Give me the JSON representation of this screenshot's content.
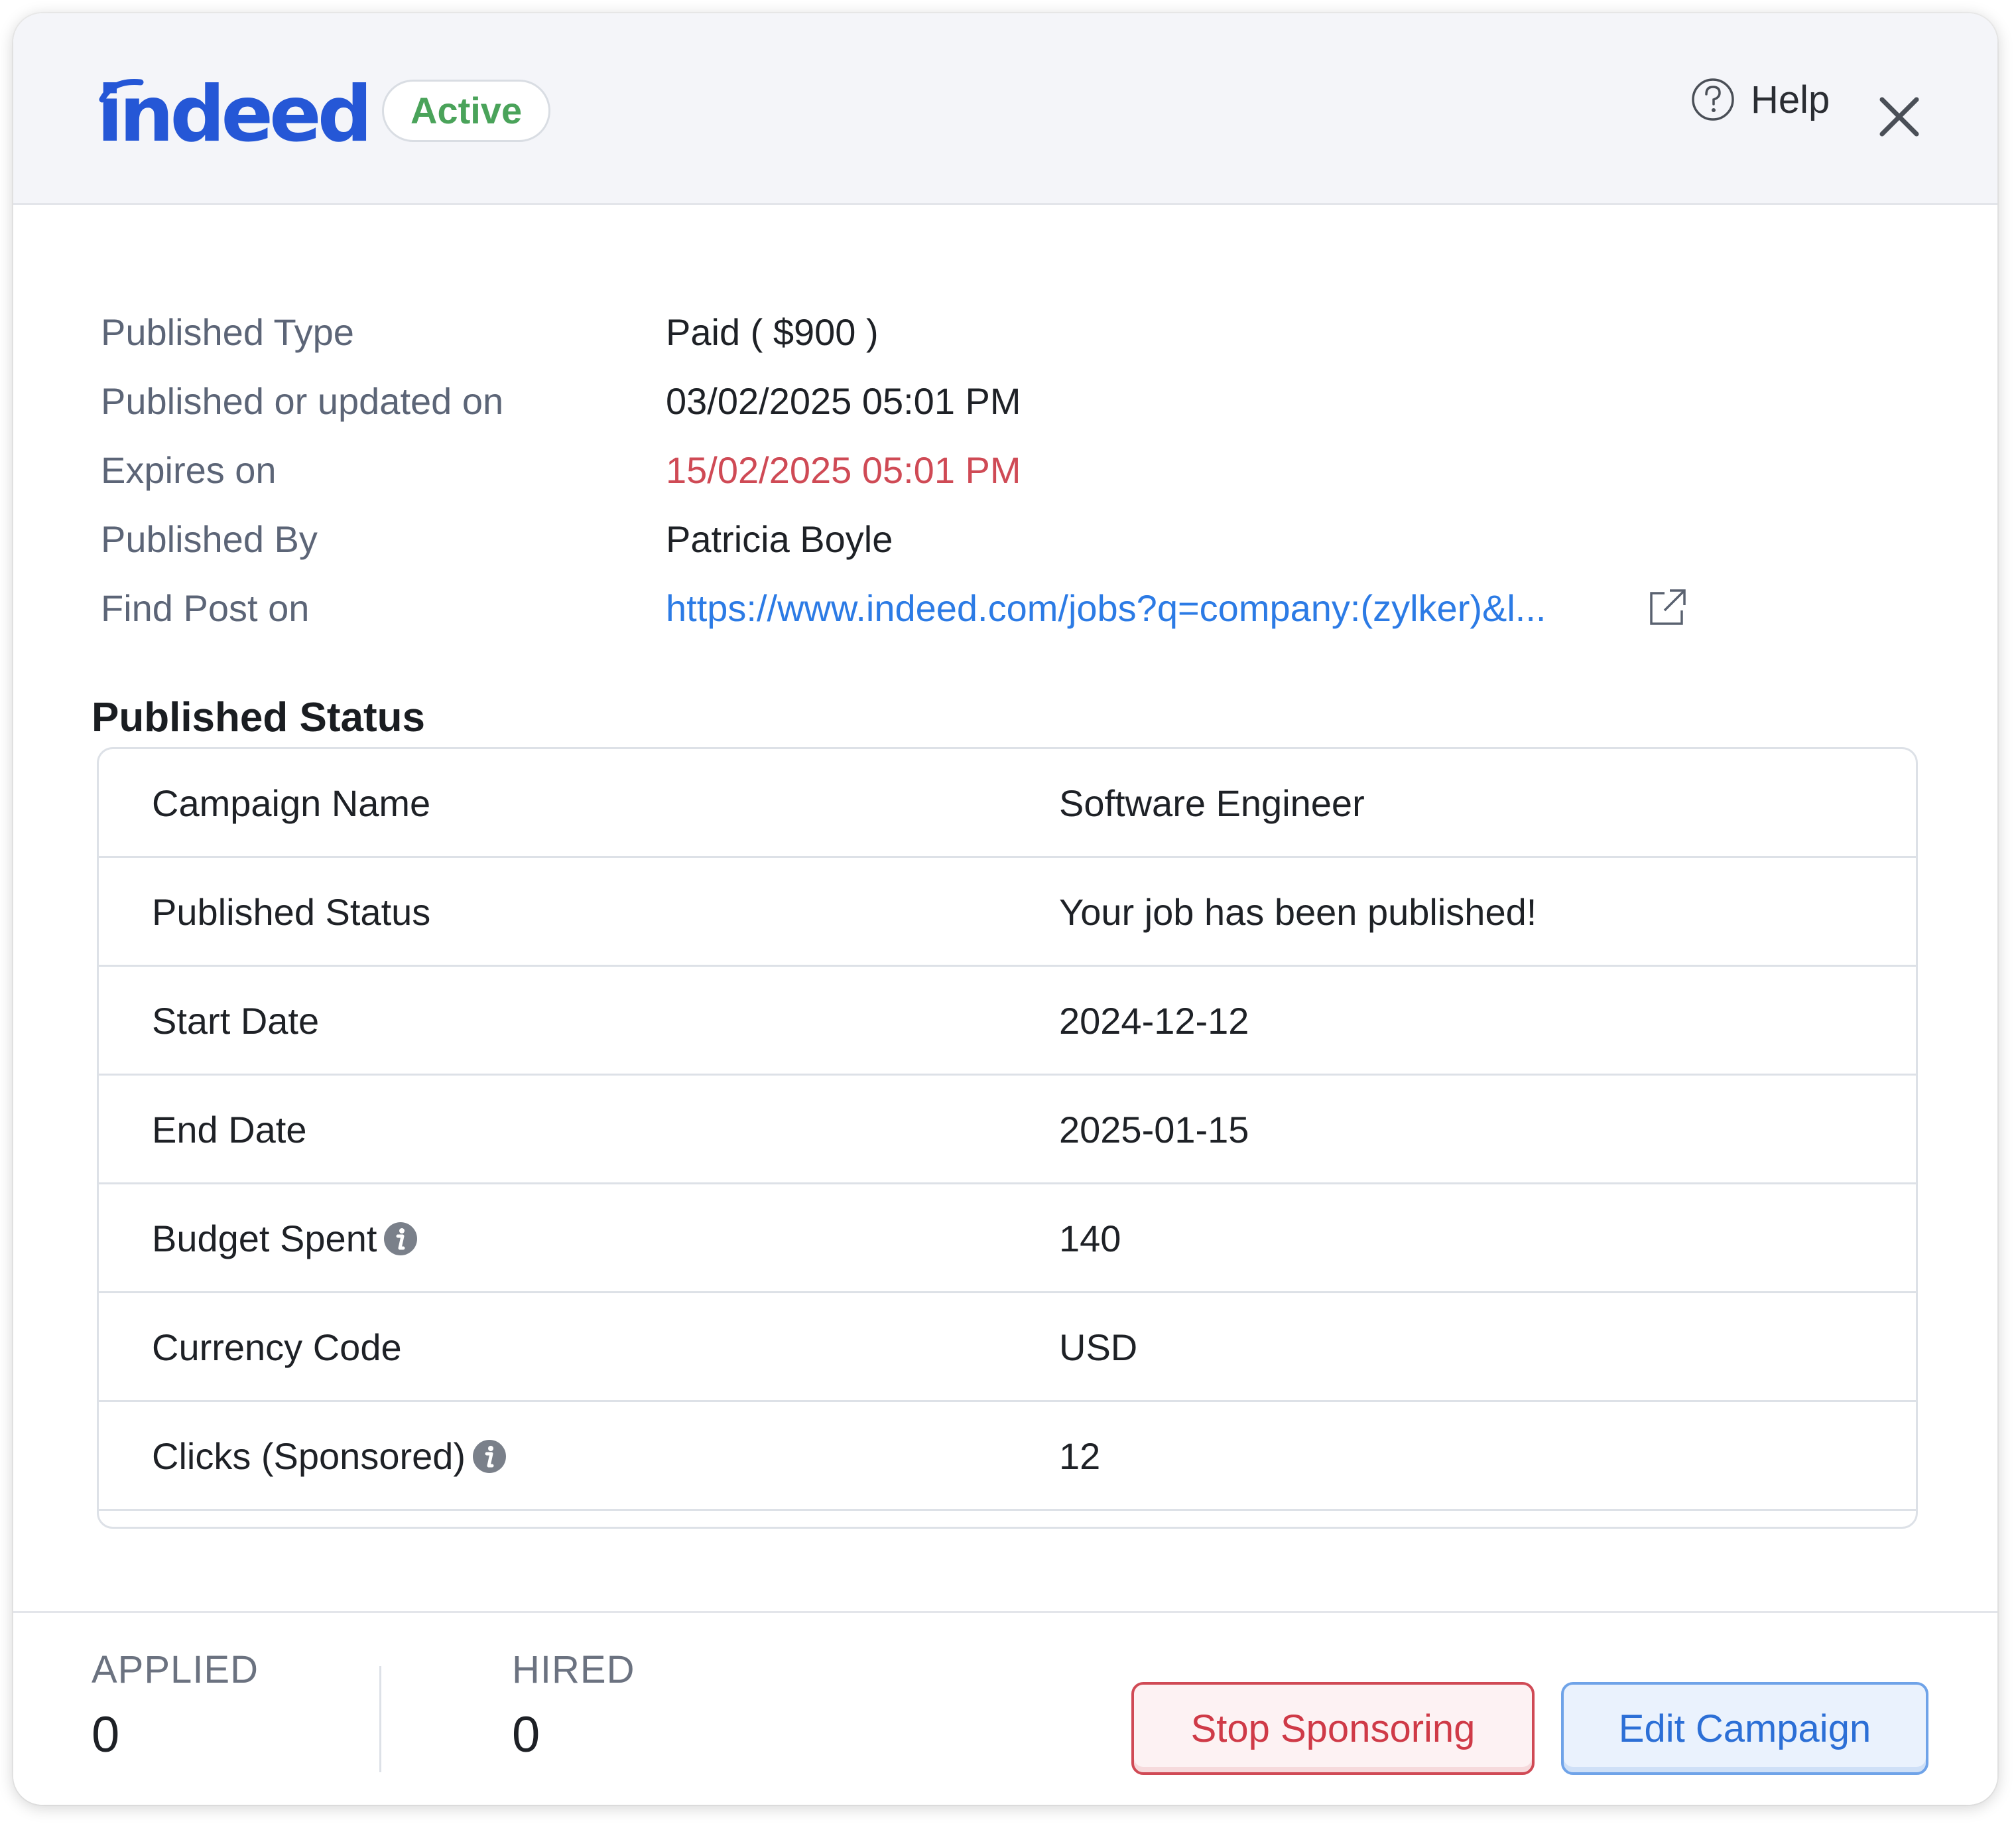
{
  "header": {
    "logo_text": "indeed",
    "status": "Active",
    "help_label": "Help"
  },
  "info": [
    {
      "label": "Published Type",
      "value": "Paid ( $900 )"
    },
    {
      "label": "Published or updated on",
      "value": "03/02/2025 05:01 PM"
    },
    {
      "label": "Expires on",
      "value": "15/02/2025 05:01 PM"
    },
    {
      "label": "Published By",
      "value": "Patricia Boyle"
    },
    {
      "label": "Find Post on",
      "value": "https://www.indeed.com/jobs?q=company:(zylker)&l..."
    }
  ],
  "status_section": {
    "title": "Published Status",
    "rows": [
      {
        "label": "Campaign Name",
        "value": "Software Engineer"
      },
      {
        "label": "Published Status",
        "value": "Your job has been published!"
      },
      {
        "label": "Start Date",
        "value": "2024-12-12"
      },
      {
        "label": "End Date",
        "value": "2025-01-15"
      },
      {
        "label": "Budget Spent",
        "value": "140"
      },
      {
        "label": "Currency Code",
        "value": "USD"
      },
      {
        "label": "Clicks (Sponsored)",
        "value": "12"
      }
    ]
  },
  "footer": {
    "applied_label": "APPLIED",
    "applied_value": "0",
    "hired_label": "HIRED",
    "hired_value": "0",
    "stop_label": "Stop Sponsoring",
    "edit_label": "Edit Campaign"
  },
  "colors": {
    "brand": "#2557d6",
    "active": "#4aa35a",
    "expired": "#cf4a55",
    "link": "#2c7be5",
    "danger": "#cf3a47"
  }
}
